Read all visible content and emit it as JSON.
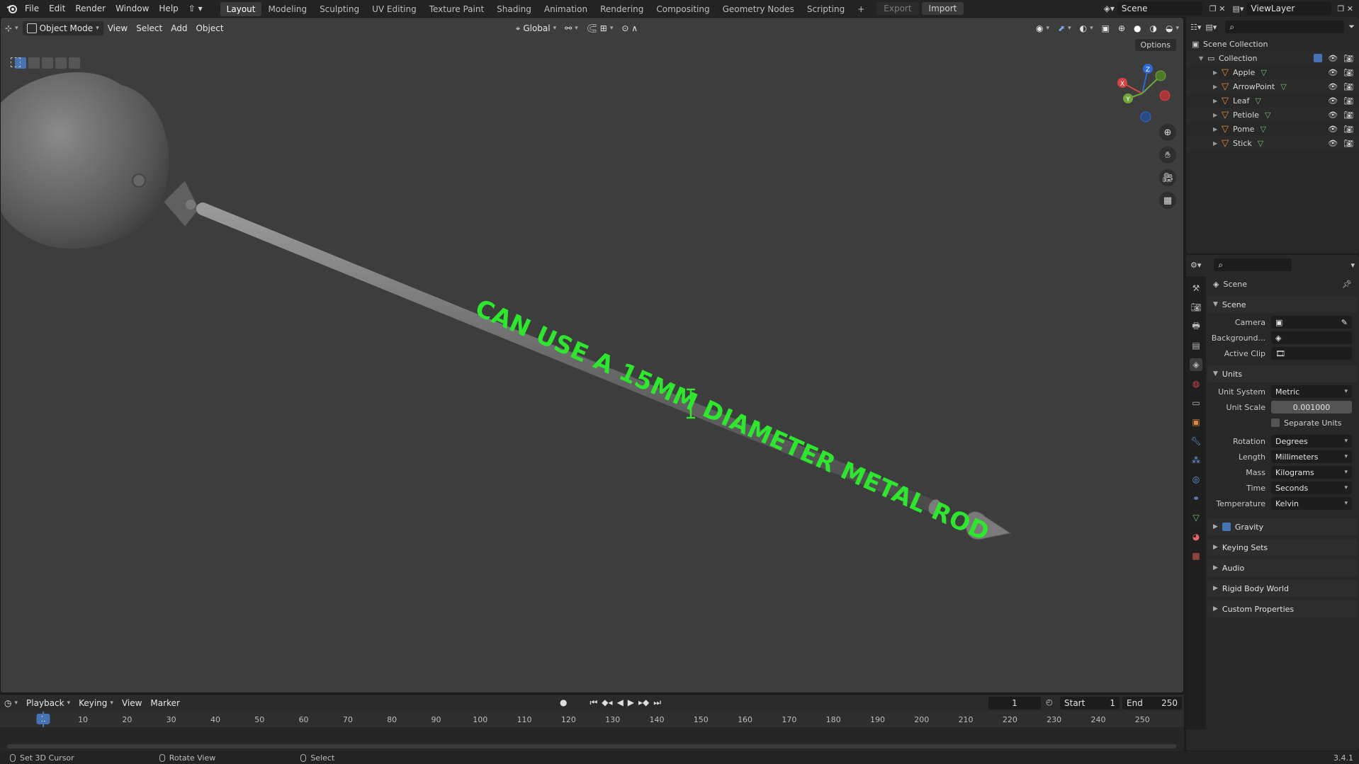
{
  "menubar": {
    "items": [
      "File",
      "Edit",
      "Render",
      "Window",
      "Help"
    ],
    "workspaces": [
      "Layout",
      "Modeling",
      "Sculpting",
      "UV Editing",
      "Texture Paint",
      "Shading",
      "Animation",
      "Rendering",
      "Compositing",
      "Geometry Nodes",
      "Scripting"
    ],
    "active_workspace": "Layout",
    "add_tab": "+",
    "export_label": "Export",
    "import_label": "Import",
    "scene_name": "Scene",
    "view_layer": "ViewLayer"
  },
  "viewport": {
    "mode": "Object Mode",
    "menus": [
      "View",
      "Select",
      "Add",
      "Object"
    ],
    "orientation": "Global",
    "options_label": "Options",
    "overlay_text": "CAN USE A 15MM DIAMETER METAL ROD",
    "overlay_color": "#2ee62e",
    "gizmo_axes": [
      "Z",
      "X",
      "Y"
    ]
  },
  "outliner": {
    "root": "Scene Collection",
    "collection": "Collection",
    "objects": [
      "Apple",
      "ArrowPoint",
      "Leaf",
      "Petiole",
      "Pome",
      "Stick"
    ]
  },
  "properties": {
    "title": "Scene",
    "scene_panel": "Scene",
    "camera_label": "Camera",
    "background_label": "Background...",
    "active_clip_label": "Active Clip",
    "units_panel": "Units",
    "unit_rows": [
      {
        "label": "Unit System",
        "value": "Metric"
      },
      {
        "label": "Unit Scale",
        "value": "0.001000"
      },
      {
        "label": "Rotation",
        "value": "Degrees"
      },
      {
        "label": "Length",
        "value": "Millimeters"
      },
      {
        "label": "Mass",
        "value": "Kilograms"
      },
      {
        "label": "Time",
        "value": "Seconds"
      },
      {
        "label": "Temperature",
        "value": "Kelvin"
      }
    ],
    "separate_units_label": "Separate Units",
    "collapsed_panels": [
      "Gravity",
      "Keying Sets",
      "Audio",
      "Rigid Body World",
      "Custom Properties"
    ]
  },
  "timeline": {
    "menus": [
      "Playback",
      "Keying",
      "View",
      "Marker"
    ],
    "current_frame": "1",
    "start_label": "Start",
    "start_value": "1",
    "end_label": "End",
    "end_value": "250",
    "ticks": [
      "10",
      "20",
      "30",
      "40",
      "50",
      "60",
      "70",
      "80",
      "90",
      "100",
      "110",
      "120",
      "130",
      "140",
      "150",
      "160",
      "170",
      "180",
      "190",
      "200",
      "210",
      "220",
      "230",
      "240",
      "250"
    ]
  },
  "statusbar": {
    "items": [
      "Set 3D Cursor",
      "Rotate View",
      "Select"
    ],
    "version": "3.4.1"
  }
}
